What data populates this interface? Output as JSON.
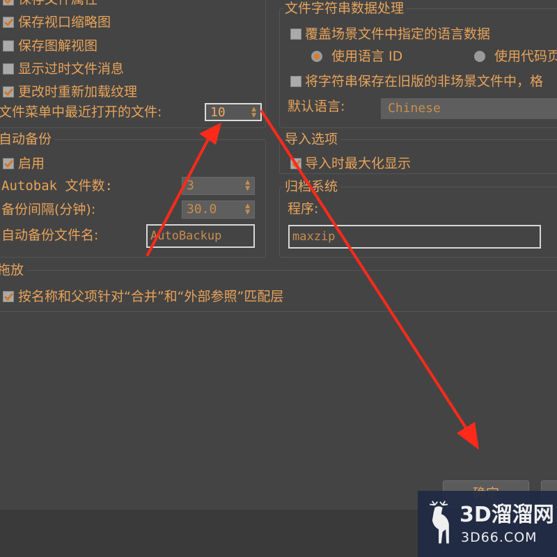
{
  "file_handling": {
    "items": [
      {
        "label": "保存文件属性",
        "checked": true
      },
      {
        "label": "保存视口缩略图",
        "checked": true
      },
      {
        "label": "保存图解视图",
        "checked": false
      },
      {
        "label": "显示过时文件消息",
        "checked": false
      },
      {
        "label": "更改时重新加载纹理",
        "checked": true
      }
    ],
    "recent_files_label": "文件菜单中最近打开的文件:",
    "recent_files_value": "10"
  },
  "auto_backup": {
    "title": "自动备份",
    "enable_label": "启用",
    "enable_checked": true,
    "count_label": "Autobak 文件数:",
    "count_value": "3",
    "interval_label": "备份间隔(分钟):",
    "interval_value": "30.0",
    "filename_label": "自动备份文件名:",
    "filename_value": "AutoBackup"
  },
  "string_data": {
    "title": "文件字符串数据处理",
    "override_label": "覆盖场景文件中指定的语言数据",
    "radio_language_id": "使用语言 ID",
    "radio_codepage": "使用代码页",
    "legacy_label": "将字符串保存在旧版的非场景文件中，格",
    "default_language_label": "默认语言:",
    "default_language_value": "Chinese"
  },
  "import_options": {
    "title": "导入选项",
    "maximize_label": "导入时最大化显示",
    "maximize_checked": true
  },
  "archive": {
    "title": "归档系统",
    "program_label": "程序:",
    "program_value": "maxzip"
  },
  "drop": {
    "title": "拖放",
    "match_label": "按名称和父项针对“合并”和“外部参照”匹配层",
    "match_checked": true
  },
  "buttons": {
    "ok": "确定"
  },
  "watermark": {
    "brand": "3D溜溜网",
    "domain": "3D66.COM"
  },
  "colors": {
    "background": "#444444",
    "label": "#e8a35a",
    "arrow": "#ff2a1a"
  }
}
